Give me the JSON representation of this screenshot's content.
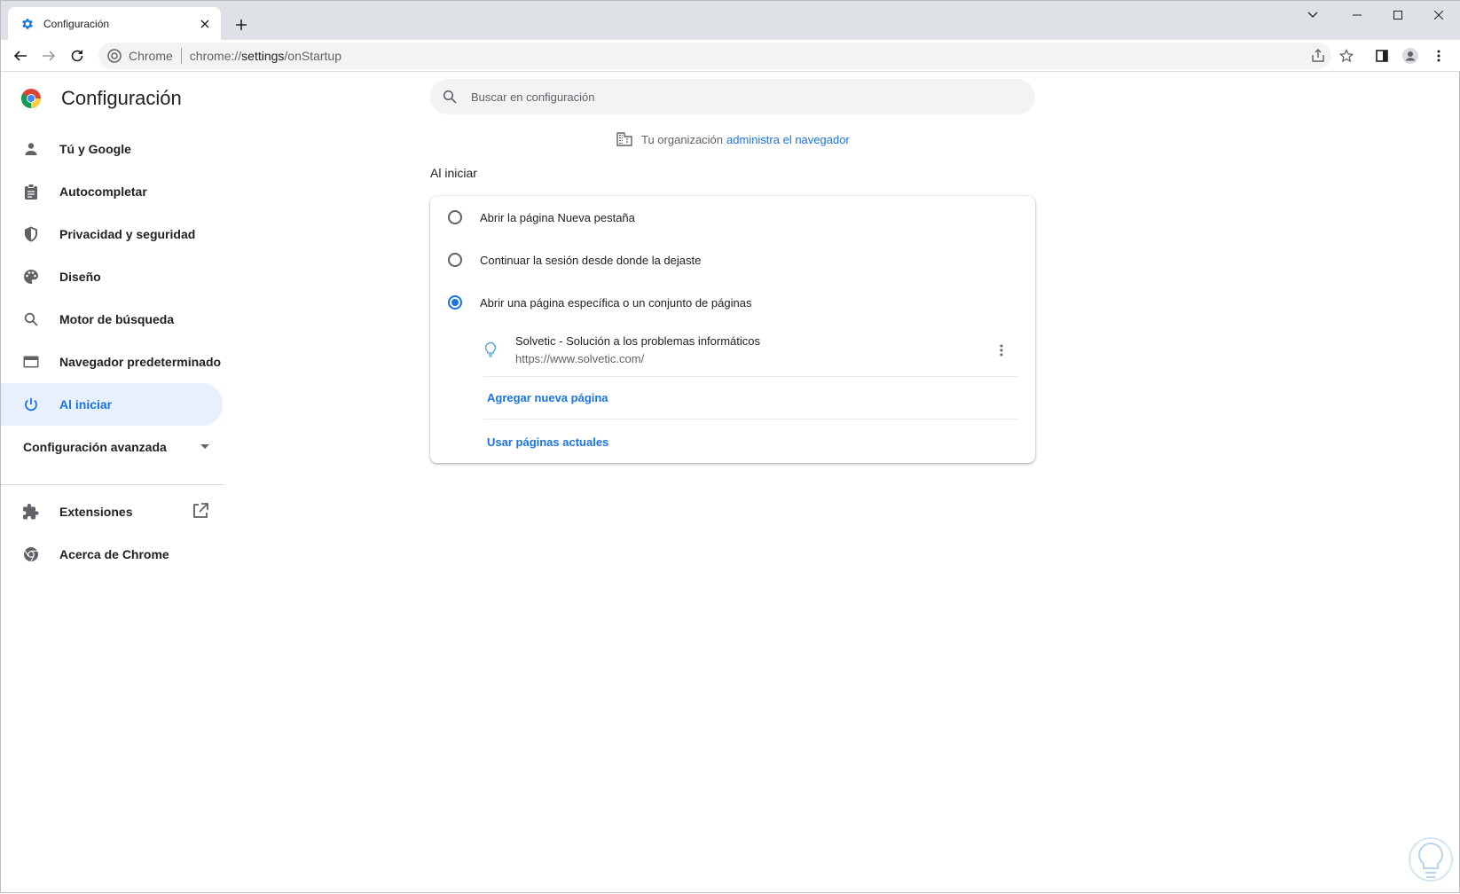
{
  "browser": {
    "tab_title": "Configuración",
    "omnibox_chip": "Chrome",
    "url_host": "chrome://",
    "url_path_main": "settings",
    "url_path_rest": "/onStartup"
  },
  "sidebar": {
    "brand": "Configuración",
    "items": [
      {
        "label": "Tú y Google",
        "icon": "person-icon"
      },
      {
        "label": "Autocompletar",
        "icon": "clipboard-icon"
      },
      {
        "label": "Privacidad y seguridad",
        "icon": "shield-icon"
      },
      {
        "label": "Diseño",
        "icon": "palette-icon"
      },
      {
        "label": "Motor de búsqueda",
        "icon": "search-icon"
      },
      {
        "label": "Navegador predeterminado",
        "icon": "browser-window-icon"
      },
      {
        "label": "Al iniciar",
        "icon": "power-icon",
        "active": true
      }
    ],
    "advanced": "Configuración avanzada",
    "extensions": "Extensiones",
    "about": "Acerca de Chrome"
  },
  "main": {
    "search_placeholder": "Buscar en configuración",
    "managed_text": "Tu organización",
    "managed_link": "administra el navegador",
    "section_title": "Al iniciar",
    "options": [
      {
        "label": "Abrir la página Nueva pestaña",
        "checked": false
      },
      {
        "label": "Continuar la sesión desde donde la dejaste",
        "checked": false
      },
      {
        "label": "Abrir una página específica o un conjunto de páginas",
        "checked": true
      }
    ],
    "startup_page": {
      "title": "Solvetic - Solución a los problemas informáticos",
      "url": "https://www.solvetic.com/"
    },
    "add_page": "Agregar nueva página",
    "use_current": "Usar páginas actuales"
  },
  "colors": {
    "accent": "#1a73e8",
    "active_bg": "#e8f0fe",
    "tabstrip": "#dee1e6"
  }
}
